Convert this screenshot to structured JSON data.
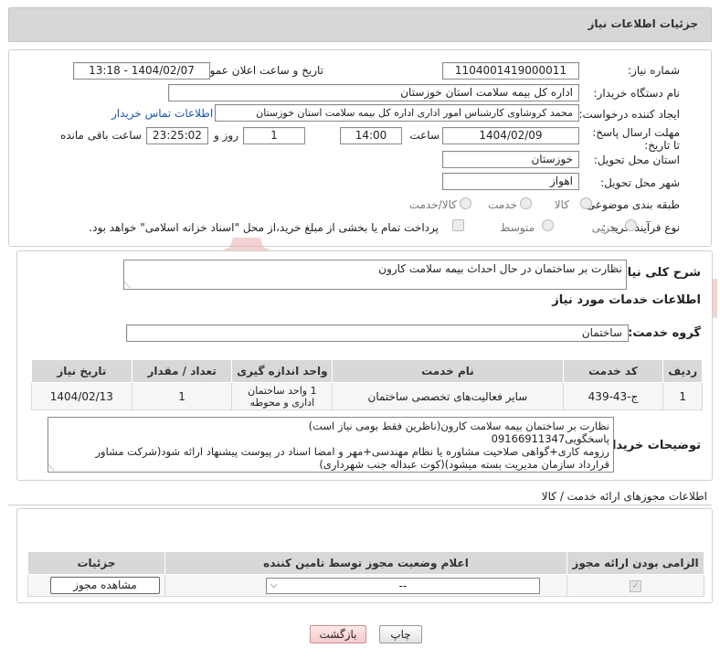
{
  "header": {
    "title": "جزئیات اطلاعات نیاز"
  },
  "form": {
    "need_number_label": "شماره نیاز:",
    "need_number": "1104001419000011",
    "announce_label": "تاریخ و ساعت اعلان عمومی:",
    "announce_value": "1404/02/07 - 13:18",
    "buyer_org_label": "نام دستگاه خریدار:",
    "buyer_org": "اداره کل بیمه سلامت استان خوزستان",
    "creator_label": "ایجاد کننده درخواست:",
    "creator": "محمد کروشاوی کارشناس امور اداری اداره کل بیمه سلامت استان خوزستان",
    "contact_link": "اطلاعات تماس خریدار",
    "deadline_label": "مهلت ارسال پاسخ: تا تاریخ:",
    "deadline_date": "1404/02/09",
    "time_label": "ساعت",
    "deadline_time": "14:00",
    "days_value": "1",
    "days_label": "روز و",
    "remaining_time": "23:25:02",
    "remaining_label": "ساعت باقی مانده",
    "province_label": "استان محل تحویل:",
    "province": "خوزستان",
    "city_label": "شهر محل تحویل:",
    "city": "اهواز",
    "category_label": "طبقه بندی موضوعی:",
    "category_options": [
      "کالا",
      "خدمت",
      "کالا/خدمت"
    ],
    "purchase_type_label": "نوع فرآیند خرید :",
    "purchase_type_options": [
      "جزیی",
      "متوسط"
    ],
    "treasury_note": "پرداخت تمام یا بخشی از مبلغ خرید،از محل \"اسناد خزانه اسلامی\" خواهد بود."
  },
  "details": {
    "summary_label": "شرح کلی نیاز:",
    "summary": "نظارت بر ساختمان در حال احداث بیمه سلامت کارون",
    "services_heading": "اطلاعات خدمات مورد نیاز",
    "service_group_label": "گروه خدمت:",
    "service_group": "ساختمان",
    "table": {
      "headers": [
        "ردیف",
        "کد خدمت",
        "نام خدمت",
        "واحد اندازه گیری",
        "تعداد / مقدار",
        "تاریخ نیاز"
      ],
      "rows": [
        [
          "1",
          "ج-43-439",
          "سایر فعالیت‌های تخصصی ساختمان",
          "1 واحد ساختمان اداری و محوطه",
          "1",
          "1404/02/13"
        ]
      ]
    },
    "buyer_notes_label": "توضیحات خریدار:",
    "buyer_notes": [
      "نظارت بر ساختمان بیمه سلامت کارون(ناظرین فقط بومی نیاز است)",
      "پاسخگویی09166911347",
      "رزومه کاری+گواهی صلاحیت مشاوره یا نظام مهندسی+مهر و امضا اسناد در پیوست پیشنهاد ارائه شود(شرکت مشاور",
      "قرارداد سازمان مدیریت بسته میشود)(کوت عبداله جنب شهرداری)"
    ]
  },
  "permits": {
    "heading": "اطلاعات مجوزهای ارائه خدمت / کالا",
    "headers": [
      "الزامی بودن ارائه مجوز",
      "اعلام وضعیت مجوز توسط تامین کننده",
      "جزئیات"
    ],
    "select_value": "--",
    "view_button": "مشاهده مجوز"
  },
  "actions": {
    "print": "چاپ",
    "back": "بازگشت"
  },
  "watermark": {
    "text": "AriaTender.neT",
    "color": "#e8b0b0"
  }
}
